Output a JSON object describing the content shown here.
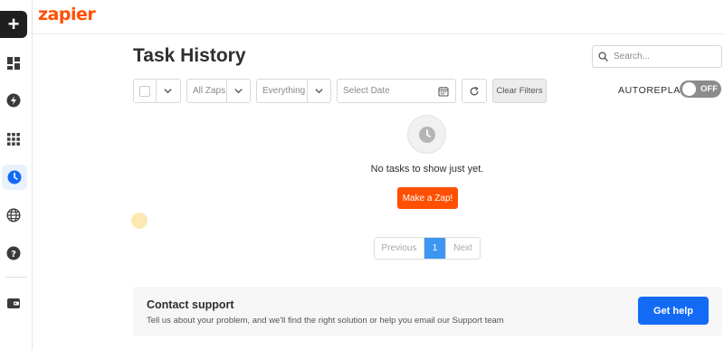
{
  "sidebar": {
    "create_label": "+",
    "items": [
      {
        "icon": "dashboard-icon"
      },
      {
        "icon": "zap-icon"
      },
      {
        "icon": "apps-grid-icon"
      },
      {
        "icon": "history-clock-icon",
        "active": true
      },
      {
        "icon": "globe-icon"
      },
      {
        "icon": "help-icon"
      },
      {
        "icon": "wallet-icon"
      }
    ]
  },
  "topbar": {
    "logo": "zapier"
  },
  "page": {
    "title": "Task History"
  },
  "search": {
    "placeholder": "Search..."
  },
  "filters": {
    "zaps_label": "All Zaps",
    "status_label": "Everything",
    "date_placeholder": "Select Date",
    "clear_label": "Clear Filters"
  },
  "autoreplay": {
    "label": "AUTOREPLAY",
    "state": "OFF"
  },
  "empty_state": {
    "message": "No tasks to show just yet.",
    "button_label": "Make a Zap!"
  },
  "pagination": {
    "previous": "Previous",
    "current": "1",
    "next": "Next"
  },
  "support": {
    "title": "Contact support",
    "description": "Tell us about your problem, and we'll find the right solution or help you email our Support team",
    "button_label": "Get help"
  },
  "colors": {
    "brand": "#ff4f00",
    "primary_button": "#136bf5",
    "pager_active": "#3d97f2",
    "toggle_off": "#8c8c8c"
  }
}
